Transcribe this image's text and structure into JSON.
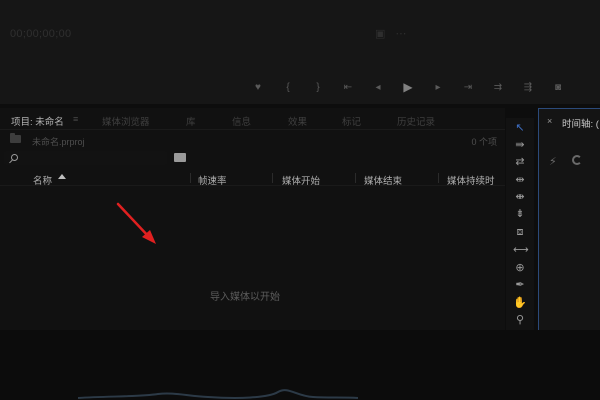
{
  "monitor": {
    "timecode": "00;00;00;00",
    "icons": [
      "export-frame-icon",
      "more-icon"
    ],
    "transport": [
      {
        "name": "marker-icon",
        "glyph": "♥"
      },
      {
        "name": "mark-in-icon",
        "glyph": "{"
      },
      {
        "name": "mark-out-icon",
        "glyph": "}"
      },
      {
        "name": "go-to-in-icon",
        "glyph": "⇤"
      },
      {
        "name": "step-back-icon",
        "glyph": "◂"
      },
      {
        "name": "play-icon",
        "glyph": "▶"
      },
      {
        "name": "step-forward-icon",
        "glyph": "▸"
      },
      {
        "name": "go-to-out-icon",
        "glyph": "⇥"
      },
      {
        "name": "insert-icon",
        "glyph": "⇉"
      },
      {
        "name": "overwrite-icon",
        "glyph": "⇶"
      },
      {
        "name": "camera-icon",
        "glyph": "◙"
      }
    ]
  },
  "project_panel": {
    "tabs": [
      {
        "label": "项目: 未命名",
        "active": true
      },
      {
        "label": "媒体浏览器"
      },
      {
        "label": "库"
      },
      {
        "label": "信息"
      },
      {
        "label": "效果"
      },
      {
        "label": "标记"
      },
      {
        "label": "历史记录"
      }
    ],
    "tab_menu_glyph": "≡",
    "path": "未命名.prproj",
    "item_count": "0 个项",
    "columns": [
      "名称",
      "帧速率",
      "媒体开始",
      "媒体结束",
      "媒体持续时"
    ],
    "empty_hint": "导入媒体以开始"
  },
  "tools": [
    {
      "name": "selection-tool-icon",
      "glyph": "↖",
      "selected": true
    },
    {
      "name": "track-select-forward-icon",
      "glyph": "⇛"
    },
    {
      "name": "ripple-edit-tool-icon",
      "glyph": "⇄"
    },
    {
      "name": "rolling-edit-tool-icon",
      "glyph": "⇹"
    },
    {
      "name": "rate-stretch-tool-icon",
      "glyph": "⇼"
    },
    {
      "name": "razor-tool-icon",
      "glyph": "⇟"
    },
    {
      "name": "slip-tool-icon",
      "glyph": "⧈"
    },
    {
      "name": "slide-tool-icon",
      "glyph": "⟷"
    },
    {
      "name": "pen-tool-icon",
      "glyph": "⊕"
    },
    {
      "name": "hand-tool-icon",
      "glyph": "✒"
    },
    {
      "name": "zoom-tool-icon",
      "glyph": "✋"
    },
    {
      "name": "magnify-tool-icon",
      "glyph": "⚲"
    }
  ],
  "timeline_panel": {
    "close_glyph": "×",
    "title": "时间轴: (",
    "icons": [
      "snap-icon",
      "linked-selection-icon"
    ]
  },
  "colors": {
    "annotation_arrow": "#e02020",
    "selected_tool": "#3e6fc5",
    "panel_focus_border": "#2b4a7a"
  }
}
